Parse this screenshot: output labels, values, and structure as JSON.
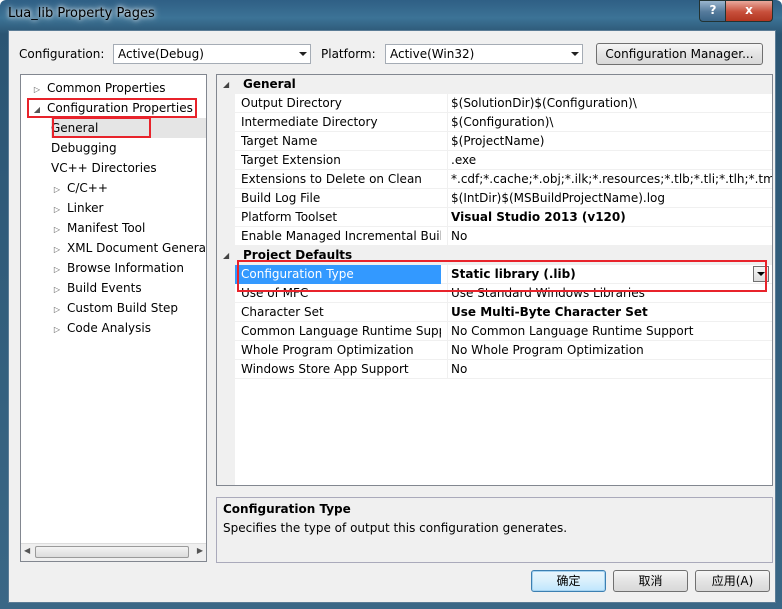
{
  "window": {
    "title": "Lua_lib Property Pages",
    "help_glyph": "?",
    "close_glyph": "x"
  },
  "toolbar": {
    "configuration_label": "Configuration:",
    "configuration_value": "Active(Debug)",
    "platform_label": "Platform:",
    "platform_value": "Active(Win32)",
    "config_manager_button": "Configuration Manager..."
  },
  "tree": {
    "items": [
      {
        "label": "Common Properties",
        "expander": "▷"
      },
      {
        "label": "Configuration Properties",
        "expander": "◢"
      },
      {
        "label": "General",
        "expander": ""
      },
      {
        "label": "Debugging",
        "expander": ""
      },
      {
        "label": "VC++ Directories",
        "expander": ""
      },
      {
        "label": "C/C++",
        "expander": "▷"
      },
      {
        "label": "Linker",
        "expander": "▷"
      },
      {
        "label": "Manifest Tool",
        "expander": "▷"
      },
      {
        "label": "XML Document Generat",
        "expander": "▷"
      },
      {
        "label": "Browse Information",
        "expander": "▷"
      },
      {
        "label": "Build Events",
        "expander": "▷"
      },
      {
        "label": "Custom Build Step",
        "expander": "▷"
      },
      {
        "label": "Code Analysis",
        "expander": "▷"
      }
    ],
    "scroll_left": "◀",
    "scroll_right": "▶"
  },
  "grid": {
    "categories": [
      {
        "name": "General",
        "expander": "◢"
      },
      {
        "name": "Project Defaults",
        "expander": "◢"
      }
    ],
    "general_rows": [
      {
        "name": "Output Directory",
        "value": "$(SolutionDir)$(Configuration)\\"
      },
      {
        "name": "Intermediate Directory",
        "value": "$(Configuration)\\"
      },
      {
        "name": "Target Name",
        "value": "$(ProjectName)"
      },
      {
        "name": "Target Extension",
        "value": ".exe"
      },
      {
        "name": "Extensions to Delete on Clean",
        "value": "*.cdf;*.cache;*.obj;*.ilk;*.resources;*.tlb;*.tli;*.tlh;*.tmp;*.r"
      },
      {
        "name": "Build Log File",
        "value": "$(IntDir)$(MSBuildProjectName).log"
      },
      {
        "name": "Platform Toolset",
        "value": "Visual Studio 2013 (v120)"
      },
      {
        "name": "Enable Managed Incremental Build",
        "value": "No"
      }
    ],
    "default_rows": [
      {
        "name": "Configuration Type",
        "value": "Static library (.lib)"
      },
      {
        "name": "Use of MFC",
        "value": "Use Standard Windows Libraries"
      },
      {
        "name": "Character Set",
        "value": "Use Multi-Byte Character Set"
      },
      {
        "name": "Common Language Runtime Support",
        "value": "No Common Language Runtime Support"
      },
      {
        "name": "Whole Program Optimization",
        "value": "No Whole Program Optimization"
      },
      {
        "name": "Windows Store App Support",
        "value": "No"
      }
    ]
  },
  "description": {
    "title": "Configuration Type",
    "text": "Specifies the type of output this configuration generates."
  },
  "buttons": {
    "ok": "确定",
    "cancel": "取消",
    "apply": "应用(A)"
  },
  "colors": {
    "highlight": "#e8232b",
    "selection": "#3399ff"
  }
}
